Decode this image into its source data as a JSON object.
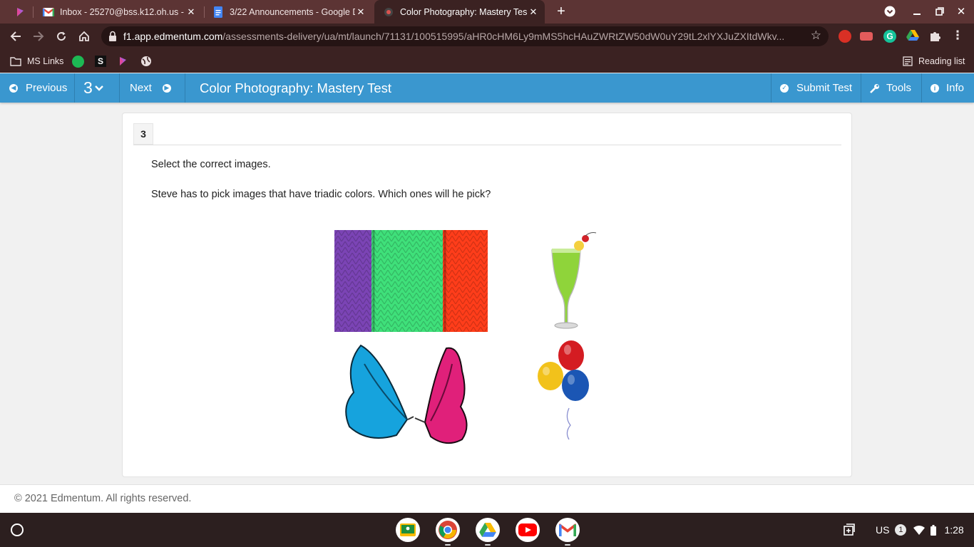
{
  "browser": {
    "tabs": [
      {
        "title": "",
        "active": false
      },
      {
        "title": "Inbox - 25270@bss.k12.oh.us - E",
        "active": false
      },
      {
        "title": "3/22 Announcements - Google D",
        "active": false
      },
      {
        "title": "Color Photography: Mastery Tes",
        "active": true
      }
    ],
    "url_host": "f1.app.edmentum.com",
    "url_path": "/assessments-delivery/ua/mt/launch/71131/100515995/aHR0cHM6Ly9mMS5hcHAuZWRtZW50dW0uY29tL2xlYXJuZXItdWkv...",
    "bookmarks": {
      "ms_links": "MS Links",
      "reading_list": "Reading list"
    }
  },
  "appbar": {
    "previous": "Previous",
    "question_number": "3",
    "next": "Next",
    "title": "Color Photography: Mastery Test",
    "submit": "Submit Test",
    "tools": "Tools",
    "info": "Info"
  },
  "question": {
    "number": "3",
    "instruction": "Select the correct images.",
    "prompt": "Steve has to pick images that have triadic colors. Which ones will he pick?"
  },
  "footer": {
    "copyright": "© 2021 Edmentum. All rights reserved."
  },
  "shelf": {
    "keyboard": "US",
    "notifications": "1",
    "time": "1:28"
  },
  "colors": {
    "appbar": "#3a97cf",
    "tabstrip": "#5c3434",
    "toolbar": "#3b2222",
    "shelf": "#2c1f1f"
  }
}
